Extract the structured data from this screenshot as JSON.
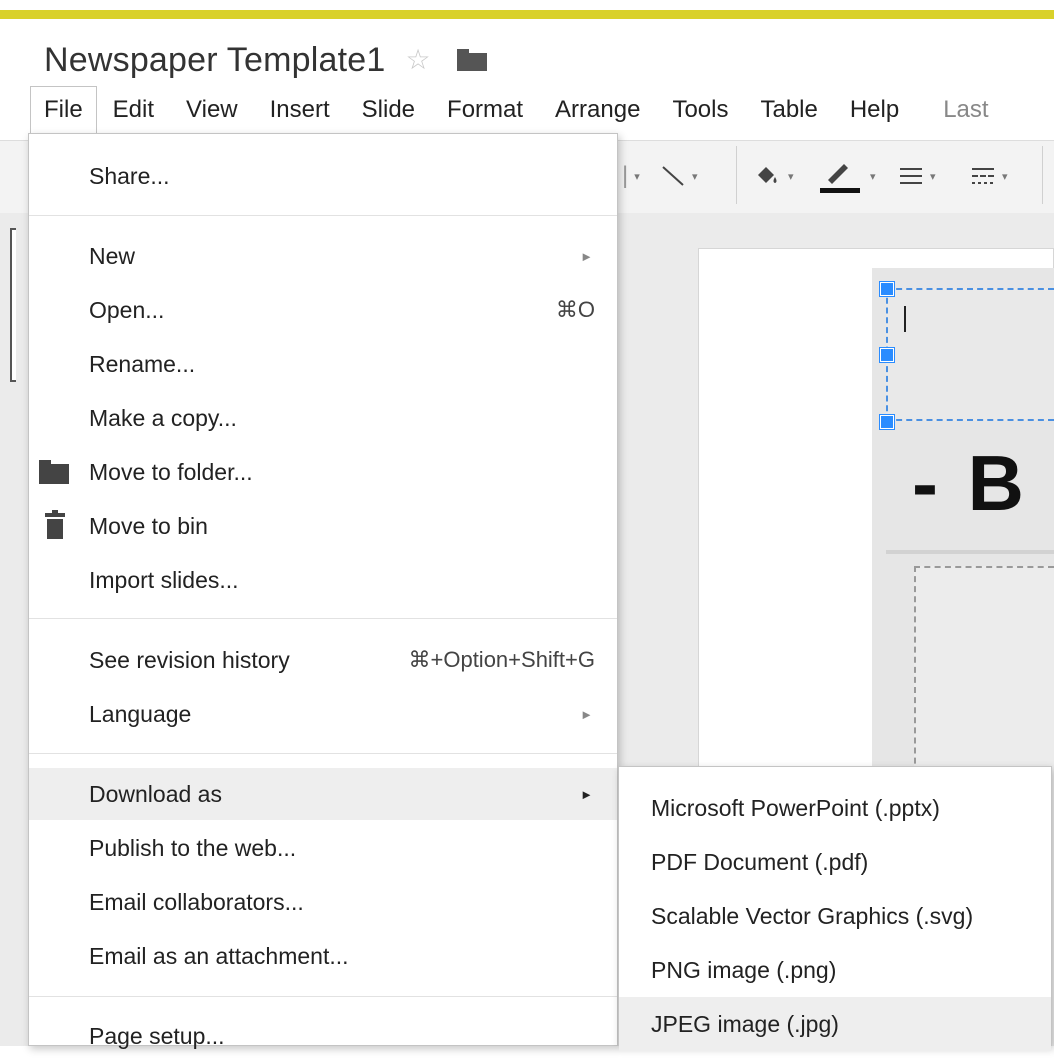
{
  "document": {
    "title": "Newspaper Template1",
    "star_icon": "star-outline-icon",
    "folder_icon": "folder-icon"
  },
  "colors": {
    "top_bar": "#d9d12a",
    "menu_highlight": "#eeeeee",
    "selection_blue": "#2a8cff"
  },
  "menubar": {
    "items": [
      "File",
      "Edit",
      "View",
      "Insert",
      "Slide",
      "Format",
      "Arrange",
      "Tools",
      "Table",
      "Help"
    ],
    "last_edit": "Last"
  },
  "toolbar": {
    "icons": [
      "shape-icon",
      "line-icon",
      "fill-color-icon",
      "border-color-icon",
      "border-weight-icon",
      "border-dash-icon"
    ]
  },
  "slide": {
    "heading_text": "- B"
  },
  "file_menu": {
    "share": "Share...",
    "new": "New",
    "open": "Open...",
    "open_shortcut": "⌘O",
    "rename": "Rename...",
    "make_copy": "Make a copy...",
    "move_to_folder": "Move to folder...",
    "move_to_bin": "Move to bin",
    "import_slides": "Import slides...",
    "revision_history": "See revision history",
    "revision_shortcut": "⌘+Option+Shift+G",
    "language": "Language",
    "download_as": "Download as",
    "publish": "Publish to the web...",
    "email_collaborators": "Email collaborators...",
    "email_attachment": "Email as an attachment...",
    "page_setup": "Page setup..."
  },
  "download_submenu": {
    "pptx": "Microsoft PowerPoint (.pptx)",
    "pdf": "PDF Document (.pdf)",
    "svg": "Scalable Vector Graphics (.svg)",
    "png": "PNG image (.png)",
    "jpg": "JPEG image (.jpg)"
  }
}
